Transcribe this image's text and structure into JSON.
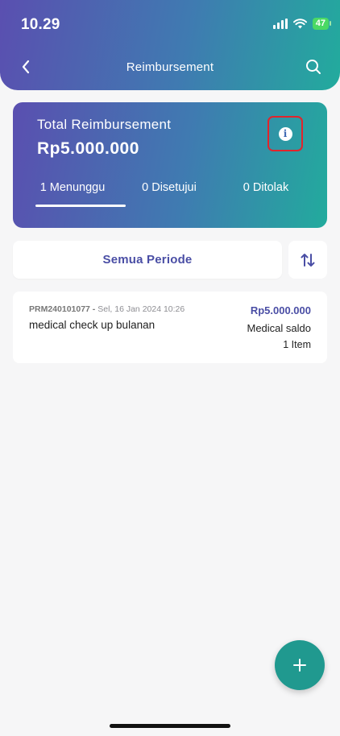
{
  "status_bar": {
    "time": "10.29",
    "battery": "47",
    "icons": [
      "signal-icon",
      "wifi-icon",
      "battery-icon"
    ]
  },
  "header": {
    "title": "Reimbursement",
    "back_icon": "chevron-left-icon",
    "search_icon": "search-icon"
  },
  "summary": {
    "label": "Total Reimbursement",
    "amount": "Rp5.000.000",
    "info_icon": "info-icon",
    "tabs": [
      {
        "label": "1 Menunggu",
        "active": true
      },
      {
        "label": "0 Disetujui",
        "active": false
      },
      {
        "label": "0 Ditolak",
        "active": false
      }
    ]
  },
  "filter": {
    "period_label": "Semua Periode",
    "sort_icon": "sort-arrows-icon"
  },
  "items": [
    {
      "code": "PRM240101077",
      "separator": " - ",
      "datetime": "Sel, 16 Jan 2024 10:26",
      "name": "medical check up bulanan",
      "amount": "Rp5.000.000",
      "category": "Medical saldo",
      "count": "1 Item"
    }
  ],
  "fab": {
    "label": "+",
    "icon": "plus-icon"
  },
  "colors": {
    "gradient_start": "#5a4fb0",
    "gradient_end": "#22ab9d",
    "accent_text": "#4a4ea5",
    "fab": "#20998f",
    "highlight_box": "#e2242c"
  }
}
